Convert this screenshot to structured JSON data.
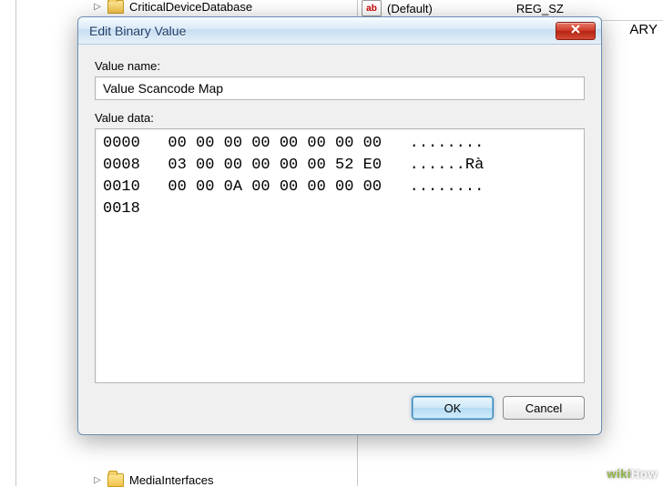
{
  "background": {
    "tree_top_item": "CriticalDeviceDatabase",
    "tree_bottom_item": "MediaInterfaces",
    "value_row": {
      "icon_text": "ab",
      "name": "(Default)",
      "type": "REG_SZ"
    },
    "right_corner_label": "ARY"
  },
  "dialog": {
    "title": "Edit Binary Value",
    "value_name_label": "Value name:",
    "value_name": "Value Scancode Map",
    "value_data_label": "Value data:",
    "hex_text": "0000   00 00 00 00 00 00 00 00   ........\n0008   03 00 00 00 00 00 52 E0   ......Rà\n0010   00 00 0A 00 00 00 00 00   ........\n0018",
    "ok_label": "OK",
    "cancel_label": "Cancel"
  },
  "watermark": {
    "prefix": "wiki",
    "suffix": "How"
  }
}
